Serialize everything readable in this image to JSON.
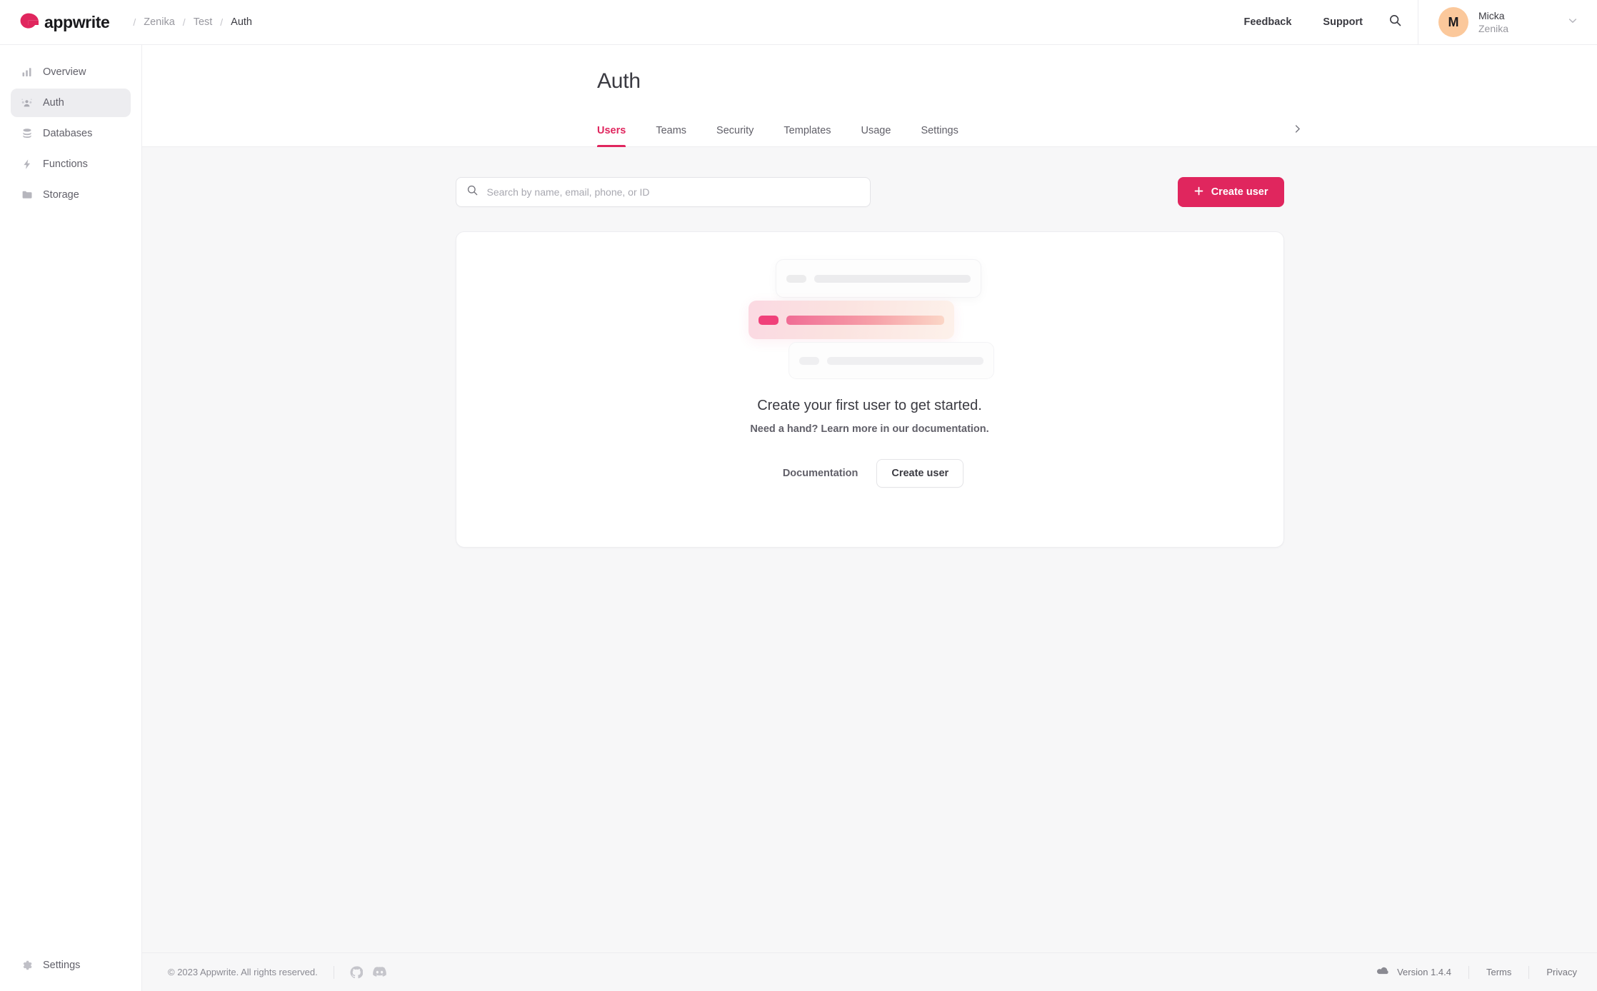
{
  "brand": {
    "name": "appwrite",
    "logo_icon": "appwrite-logo-icon"
  },
  "breadcrumb": {
    "separator": "/",
    "items": [
      "Zenika",
      "Test",
      "Auth"
    ]
  },
  "topbar": {
    "feedback_label": "Feedback",
    "support_label": "Support",
    "search_icon": "search-icon",
    "chevron_icon": "chevron-down-icon",
    "user": {
      "initial": "M",
      "name": "Micka",
      "org": "Zenika"
    }
  },
  "sidebar": {
    "items": [
      {
        "label": "Overview",
        "icon": "bar-chart-icon",
        "active": false
      },
      {
        "label": "Auth",
        "icon": "users-icon",
        "active": true
      },
      {
        "label": "Databases",
        "icon": "database-icon",
        "active": false
      },
      {
        "label": "Functions",
        "icon": "bolt-icon",
        "active": false
      },
      {
        "label": "Storage",
        "icon": "folder-icon",
        "active": false
      }
    ],
    "bottom": {
      "label": "Settings",
      "icon": "gear-icon"
    }
  },
  "page": {
    "title": "Auth",
    "tabs": [
      {
        "label": "Users",
        "active": true
      },
      {
        "label": "Teams",
        "active": false
      },
      {
        "label": "Security",
        "active": false
      },
      {
        "label": "Templates",
        "active": false
      },
      {
        "label": "Usage",
        "active": false
      },
      {
        "label": "Settings",
        "active": false
      }
    ],
    "tabs_next_icon": "chevron-right-icon"
  },
  "toolbar": {
    "search_placeholder": "Search by name, email, phone, or ID",
    "search_value": "",
    "search_icon": "search-icon",
    "create_label": "Create user",
    "create_icon": "plus-icon"
  },
  "empty_state": {
    "illustration": "user-rows-skeleton-illustration",
    "title": "Create your first user to get started.",
    "subtitle": "Need a hand? Learn more in our documentation.",
    "documentation_label": "Documentation",
    "create_label": "Create user"
  },
  "footer": {
    "copyright": "© 2023 Appwrite. All rights reserved.",
    "github_icon": "github-icon",
    "discord_icon": "discord-icon",
    "cloud_icon": "cloud-icon",
    "version": "Version 1.4.4",
    "terms_label": "Terms",
    "privacy_label": "Privacy"
  },
  "colors": {
    "accent": "#e0265e",
    "page_bg": "#f7f7f8",
    "surface": "#ffffff",
    "border": "#ededf0",
    "text": "#3b3b42",
    "muted": "#97979e",
    "avatar_bg": "#fbc89b"
  }
}
